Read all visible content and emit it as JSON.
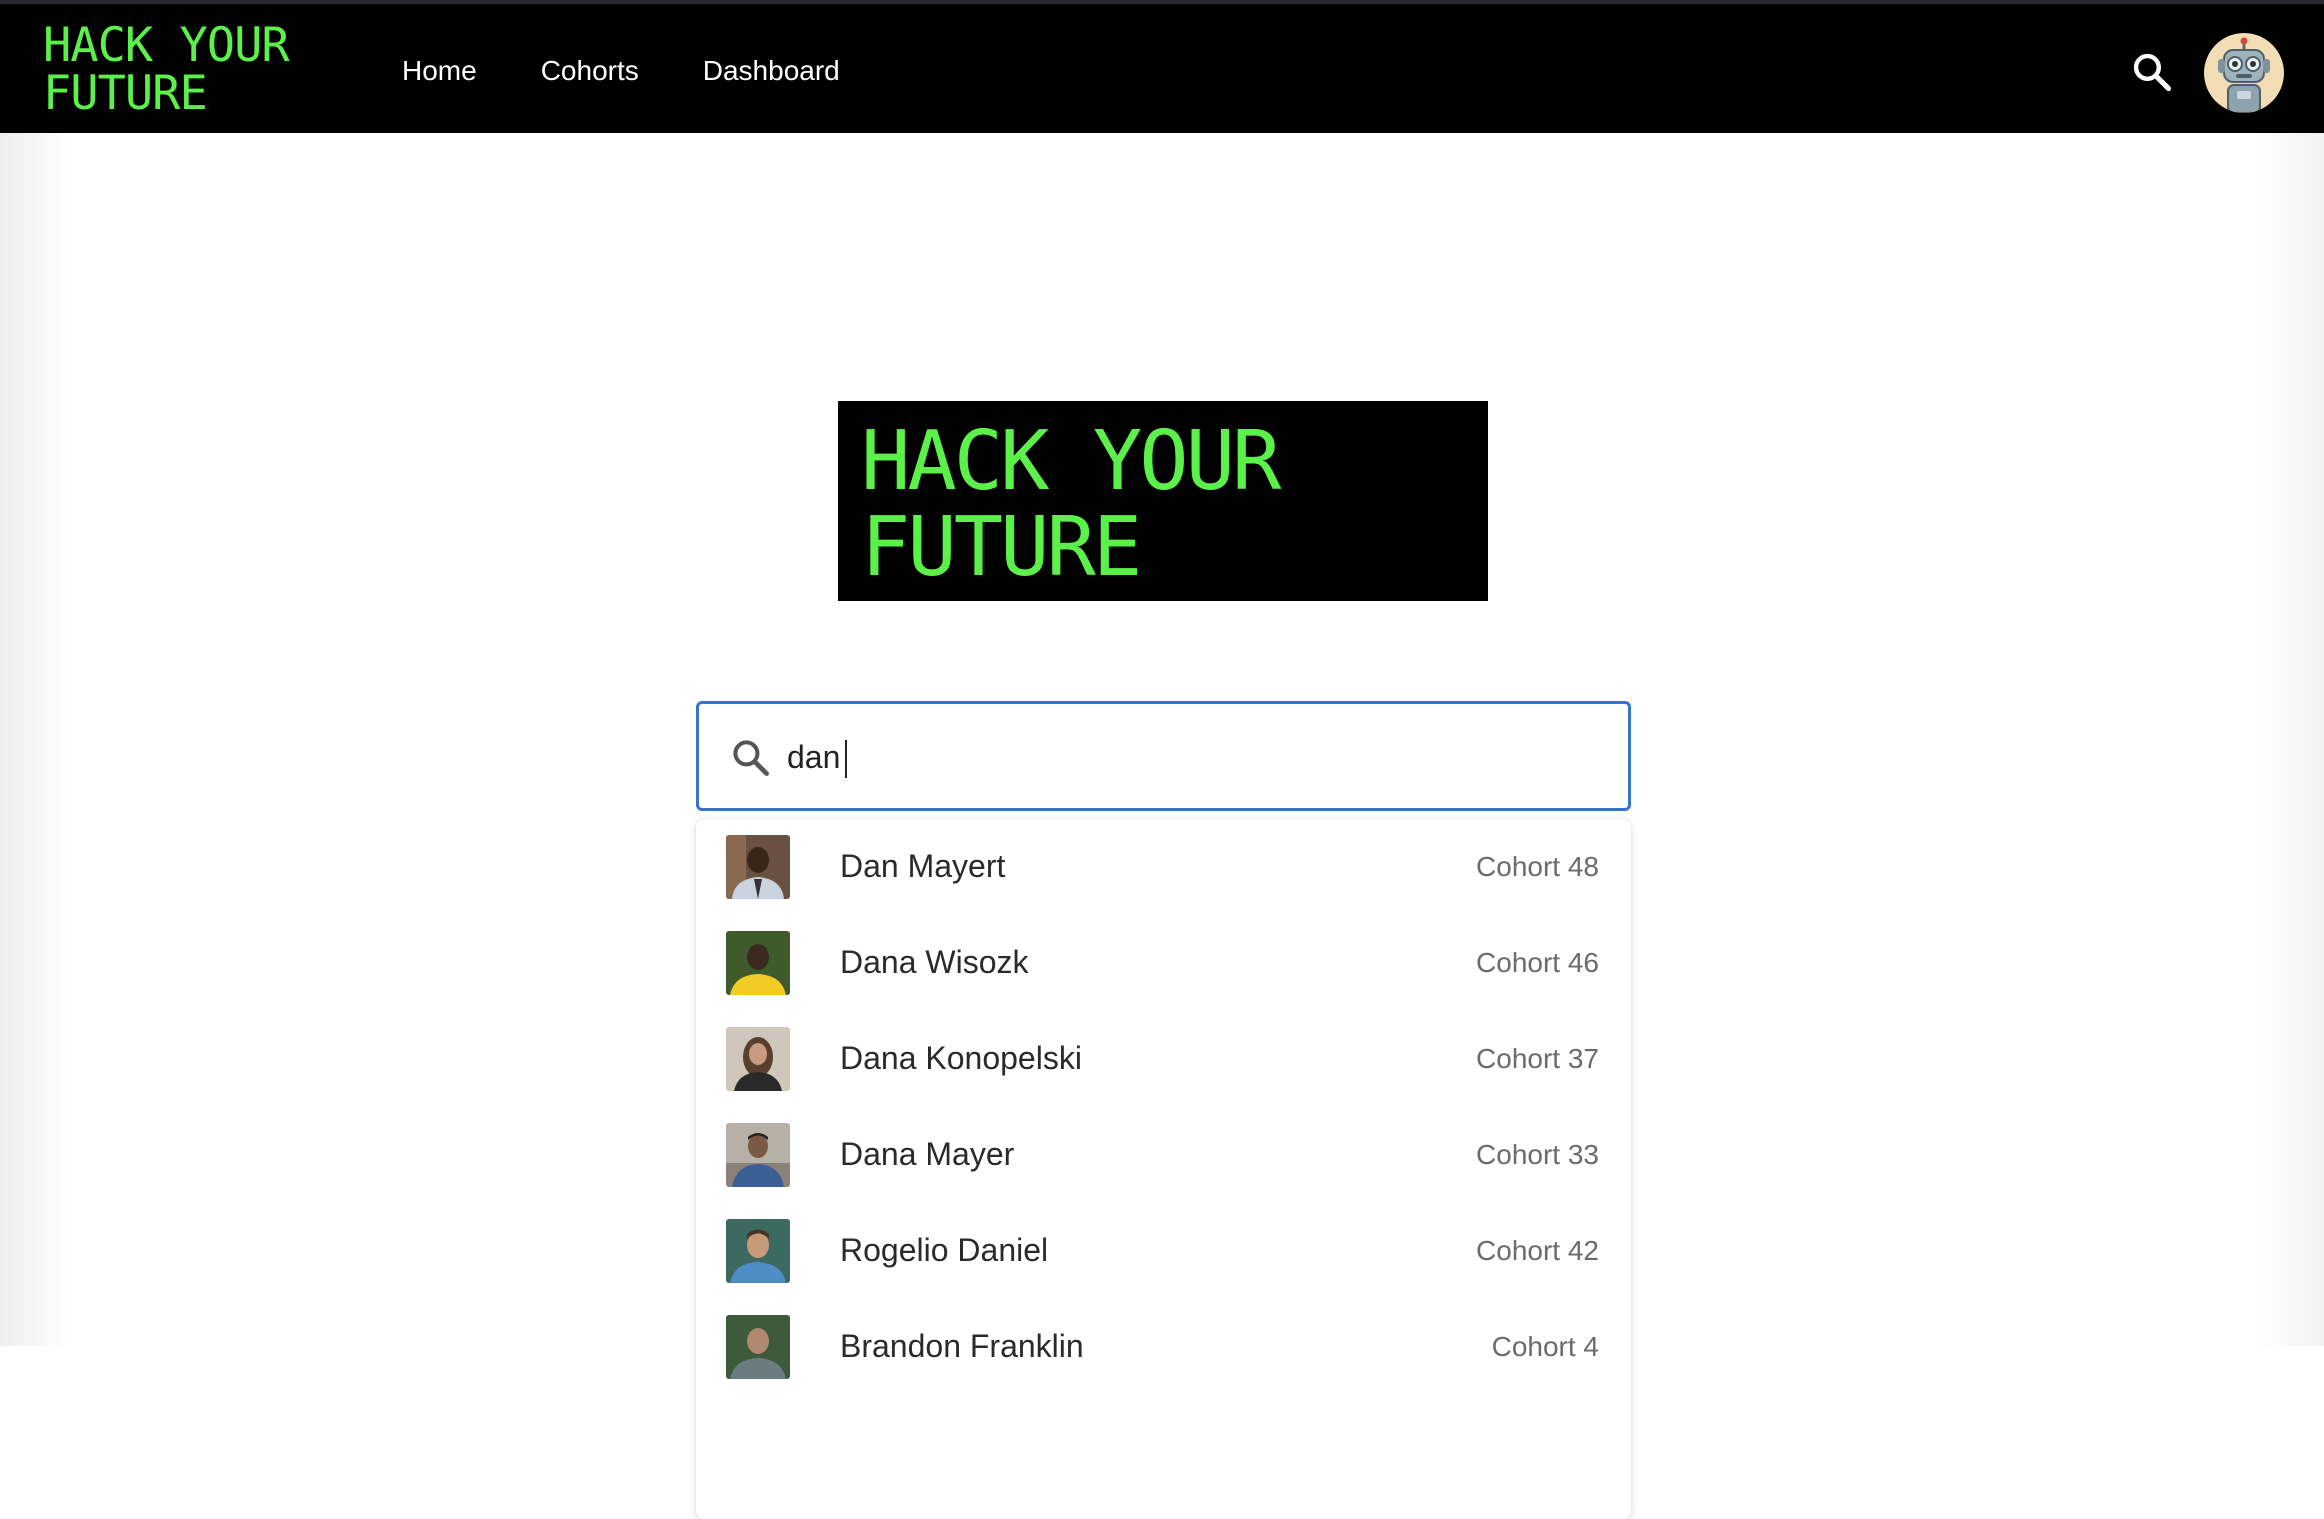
{
  "header": {
    "brand": "HACK YOUR\nFUTURE",
    "nav": [
      "Home",
      "Cohorts",
      "Dashboard"
    ],
    "search_icon": "search-icon",
    "avatar_icon": "robot-avatar-icon"
  },
  "hero": {
    "logo": "HACK YOUR\nFUTURE"
  },
  "search": {
    "value": "dan",
    "icon": "search-icon"
  },
  "results": [
    {
      "name": "Dan Mayert",
      "cohort": "Cohort 48",
      "photo_colors": [
        "#6a5040",
        "#c9d3de",
        "#33323a"
      ]
    },
    {
      "name": "Dana Wisozk",
      "cohort": "Cohort 46",
      "photo_colors": [
        "#3f5b2c",
        "#f0cc25",
        "#3a2a20"
      ]
    },
    {
      "name": "Dana Konopelski",
      "cohort": "Cohort 37",
      "photo_colors": [
        "#cfc7bb",
        "#2a2a2a",
        "#c89c82"
      ]
    },
    {
      "name": "Dana Mayer",
      "cohort": "Cohort 33",
      "photo_colors": [
        "#b7b0a6",
        "#3b5f95",
        "#7a5a45"
      ]
    },
    {
      "name": "Rogelio Daniel",
      "cohort": "Cohort 42",
      "photo_colors": [
        "#3d6a60",
        "#4d8cc4",
        "#c79a7c"
      ]
    },
    {
      "name": "Brandon Franklin",
      "cohort": "Cohort 4",
      "photo_colors": [
        "#3d5a3a",
        "#6b7b80",
        "#b08870"
      ]
    }
  ],
  "colors": {
    "brand_green": "#5cf04a",
    "focus_blue": "#3873cc"
  }
}
